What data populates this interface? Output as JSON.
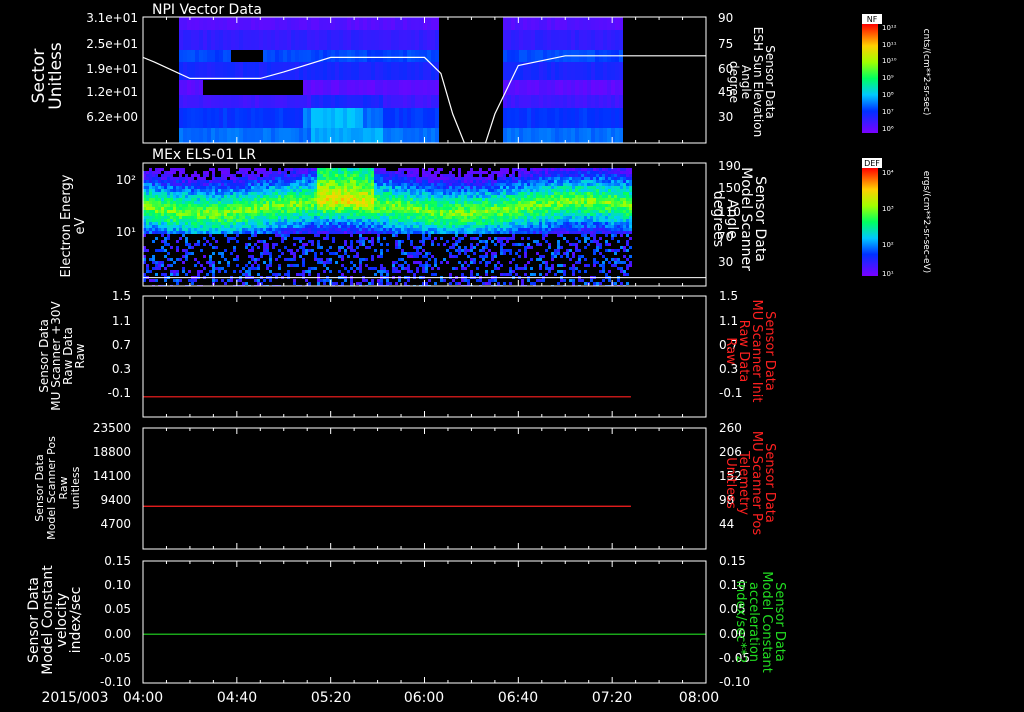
{
  "colors": {
    "background": "#000000",
    "text": "#ffffff",
    "frame": "#ffffff",
    "red_line": "#ff2020",
    "green_line": "#22dd22",
    "sun_curve": "#ffffff"
  },
  "time_axis": {
    "date": "2015/003",
    "ticks": [
      "04:00",
      "04:40",
      "05:20",
      "06:00",
      "06:40",
      "07:20",
      "08:00"
    ]
  },
  "panels": [
    {
      "id": "p1",
      "title": "NPI Vector Data",
      "left_label": [
        "Sector",
        "Unitless"
      ],
      "left_ticks": [
        "3.1e+01",
        "2.5e+01",
        "1.9e+01",
        "1.2e+01",
        "6.2e+00"
      ],
      "right_ticks": [
        "90",
        "75",
        "60",
        "45",
        "30"
      ],
      "right_label": [
        "Sensor Data",
        "ESH Sun Elevation",
        "Angle",
        "degree"
      ],
      "colorbar": {
        "tag": "NF",
        "unit": "cnts/(cm**2-sr-sec)",
        "ticks": [
          "10¹²",
          "10¹¹",
          "10¹⁰",
          "10⁹",
          "10⁸",
          "10⁷",
          "10⁶"
        ]
      }
    },
    {
      "id": "p2",
      "title": "MEx ELS-01 LR",
      "left_label": [
        "Electron Energy",
        "eV"
      ],
      "left_ticks": [
        "10²",
        "10¹"
      ],
      "right_ticks": [
        "190",
        "150",
        "110",
        "70",
        "30"
      ],
      "right_label": [
        "Sensor Data",
        "Model Scanner",
        "Angle",
        "degrees"
      ],
      "colorbar": {
        "tag": "DEF",
        "unit": "ergs/(cm**2-sr-sec-eV)",
        "ticks": [
          "10⁴",
          "10³",
          "10²",
          "10¹"
        ]
      }
    },
    {
      "id": "p3",
      "left_label": [
        "Sensor Data",
        "MU Scanner +30V",
        "Raw Data",
        "Raw"
      ],
      "left_ticks": [
        "1.5",
        "1.1",
        "0.7",
        "0.3",
        "-0.1"
      ],
      "right_ticks": [
        "1.5",
        "1.1",
        "0.7",
        "0.3",
        "-0.1"
      ],
      "right_label": [
        "Sensor Data",
        "MU Scanner Init",
        "Raw Data",
        "Raw"
      ]
    },
    {
      "id": "p4",
      "left_label": [
        "Sensor Data",
        "Model Scanner Pos",
        "Raw",
        "unitless"
      ],
      "left_ticks": [
        "23500",
        "18800",
        "14100",
        "9400",
        "4700"
      ],
      "right_ticks": [
        "260",
        "206",
        "152",
        "98",
        "44"
      ],
      "right_label": [
        "Sensor Data",
        "MU Scanner Pos",
        "Telemetry",
        "Unitless"
      ]
    },
    {
      "id": "p5",
      "left_label": [
        "Sensor Data",
        "Model Constant",
        "velocity",
        "index/sec"
      ],
      "left_ticks": [
        "0.15",
        "0.10",
        "0.05",
        "0.00",
        "-0.05",
        "-0.10"
      ],
      "right_ticks": [
        "0.15",
        "0.10",
        "0.05",
        "0.00",
        "-0.05",
        "-0.10"
      ],
      "right_label": [
        "Sensor Data",
        "Model Constant",
        "acceleration",
        "index/sec**2"
      ]
    }
  ],
  "chart_data": [
    {
      "type": "heatmap",
      "title": "NPI Vector Data",
      "x_range": [
        "04:00",
        "08:00"
      ],
      "ylim": [
        0,
        31
      ],
      "y_ticks": [
        31,
        25,
        19,
        12,
        6.2
      ],
      "data_gaps": [
        [
          "04:00",
          "04:15"
        ],
        [
          "06:07",
          "06:33"
        ],
        [
          "07:25",
          "08:00"
        ]
      ],
      "overlay_series": {
        "name": "ESH Sun Elevation Angle",
        "x": [
          "04:00",
          "04:05",
          "04:20",
          "04:50",
          "05:00",
          "05:20",
          "06:00",
          "06:07",
          "06:12",
          "06:17",
          "06:26",
          "06:30",
          "06:40",
          "07:00",
          "07:30",
          "08:00"
        ],
        "y": [
          65,
          62,
          52,
          52,
          56,
          65,
          65,
          55,
          30,
          12,
          12,
          30,
          60,
          66,
          66,
          66
        ],
        "y_axis": "right",
        "ylim": [
          12,
          90
        ]
      }
    },
    {
      "type": "heatmap",
      "title": "MEx ELS-01 LR",
      "x_range": [
        "04:00",
        "08:00"
      ],
      "y_scale": "log",
      "y_ticks": [
        100,
        10
      ],
      "data_gaps": [
        [
          "07:28",
          "08:00"
        ]
      ],
      "overlay_series": {
        "name": "Model Scanner Angle",
        "x": [
          "04:00",
          "08:00"
        ],
        "y": [
          13,
          13
        ],
        "y_axis": "right",
        "ylim": [
          0,
          190
        ]
      }
    },
    {
      "type": "line",
      "x_range": [
        "04:00",
        "08:00"
      ],
      "ylim": [
        -0.3,
        1.5
      ],
      "y_ticks": [
        1.5,
        1.1,
        0.7,
        0.3,
        -0.1
      ],
      "series": [
        {
          "x": [
            "04:00",
            "07:28"
          ],
          "y": [
            0,
            0
          ]
        }
      ]
    },
    {
      "type": "line",
      "x_range": [
        "04:00",
        "08:00"
      ],
      "ylim": [
        0,
        23500
      ],
      "y_ticks": [
        23500,
        18800,
        14100,
        9400,
        4700
      ],
      "series": [
        {
          "x": [
            "04:00",
            "07:28"
          ],
          "y": [
            8300,
            8300
          ]
        }
      ]
    },
    {
      "type": "line",
      "x_range": [
        "04:00",
        "08:00"
      ],
      "ylim": [
        -0.1,
        0.15
      ],
      "y_ticks": [
        0.15,
        0.1,
        0.05,
        0.0,
        -0.05,
        -0.1
      ],
      "series": [
        {
          "x": [
            "04:00",
            "08:00"
          ],
          "y": [
            0,
            0
          ]
        }
      ]
    }
  ]
}
